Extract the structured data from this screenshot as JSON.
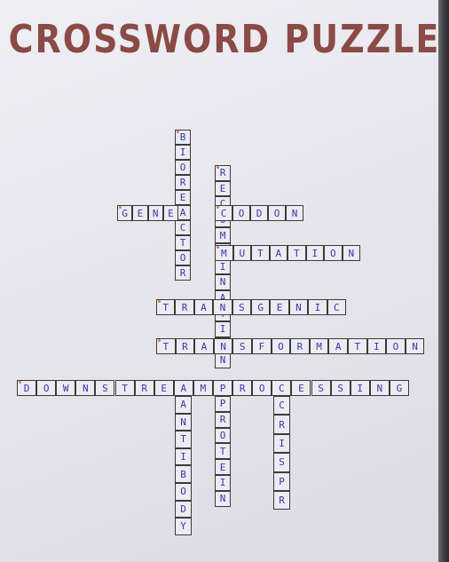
{
  "title": "CROSSWORD PUZZLE",
  "colors": {
    "title": "#8a4a45",
    "letters": "#2f3aa8",
    "grid": "#3b3b3b"
  },
  "entries": [
    {
      "answer": "BIOREACTOR",
      "direction": "down"
    },
    {
      "answer": "RECOMBINATION",
      "direction": "down"
    },
    {
      "answer": "GENE",
      "direction": "across"
    },
    {
      "answer": "CODON",
      "direction": "across"
    },
    {
      "answer": "MUTATION",
      "direction": "across"
    },
    {
      "answer": "TRANSGENIC",
      "direction": "across"
    },
    {
      "answer": "TRANSFORMATION",
      "direction": "across"
    },
    {
      "answer": "DOWNSTREAMPROCESSING",
      "direction": "across"
    },
    {
      "answer": "ANTIBODY",
      "direction": "down"
    },
    {
      "answer": "PROTEIN",
      "direction": "down"
    },
    {
      "answer": "CRISPR",
      "direction": "down"
    }
  ]
}
